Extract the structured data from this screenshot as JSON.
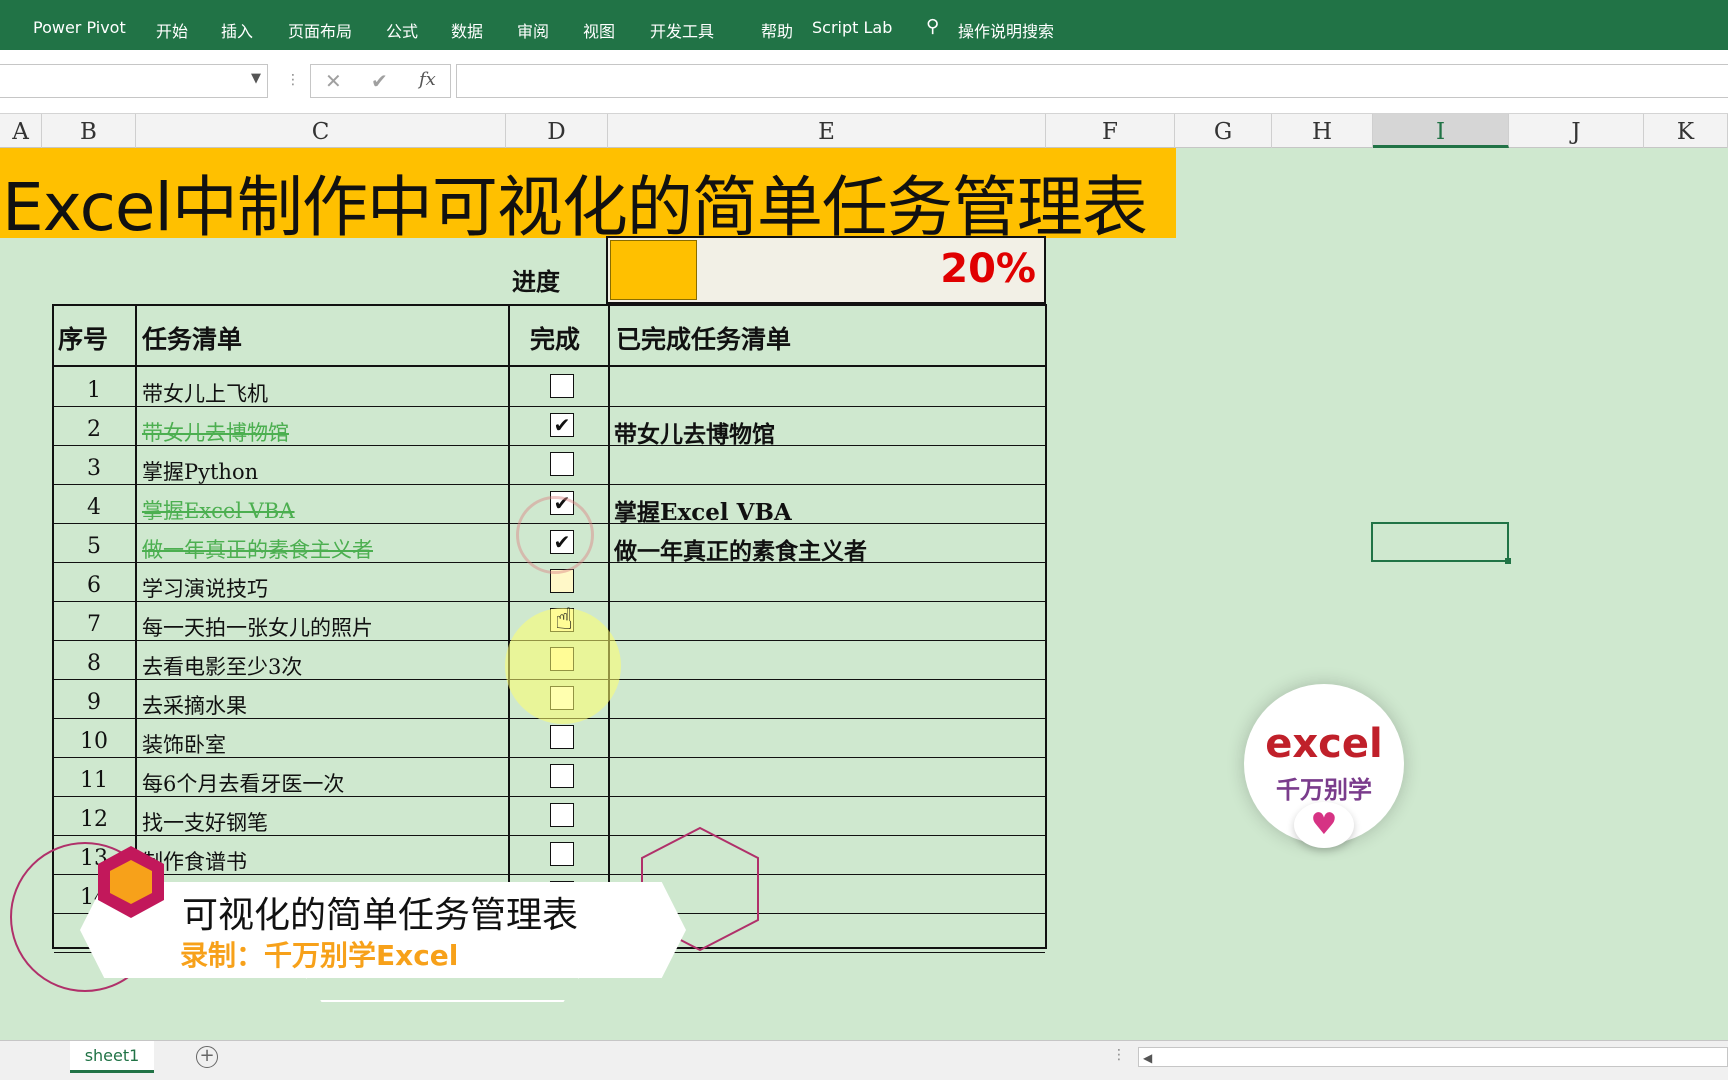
{
  "ribbon": {
    "tabs": [
      "Power Pivot",
      "开始",
      "插入",
      "页面布局",
      "公式",
      "数据",
      "审阅",
      "视图",
      "开发工具",
      "帮助",
      "Script Lab"
    ],
    "tell_me": "操作说明搜索",
    "accent_color": "#217346"
  },
  "formula_bar": {
    "name_box": "",
    "formula": "",
    "cancel_icon": "✕",
    "enter_icon": "✔",
    "fx_label": "fx"
  },
  "columns": [
    "A",
    "B",
    "C",
    "D",
    "E",
    "F",
    "G",
    "H",
    "I",
    "J",
    "K"
  ],
  "selected_column": "I",
  "title": "Excel中制作中可视化的简单任务管理表",
  "progress": {
    "label": "进度",
    "percent_text": "20%",
    "fraction": 0.2,
    "bar_color": "#ffc000",
    "text_color": "#e00000"
  },
  "table": {
    "headers": {
      "num": "序号",
      "task": "任务清单",
      "done": "完成",
      "completed": "已完成任务清单"
    },
    "rows": [
      {
        "num": "1",
        "task": "带女儿上飞机",
        "done": false,
        "completed": ""
      },
      {
        "num": "2",
        "task": "带女儿去博物馆",
        "done": true,
        "completed": "带女儿去博物馆"
      },
      {
        "num": "3",
        "task": "掌握Python",
        "done": false,
        "completed": ""
      },
      {
        "num": "4",
        "task": "掌握Excel VBA",
        "done": true,
        "completed": "掌握Excel VBA"
      },
      {
        "num": "5",
        "task": "做一年真正的素食主义者",
        "done": true,
        "completed": "做一年真正的素食主义者"
      },
      {
        "num": "6",
        "task": "学习演说技巧",
        "done": false,
        "completed": ""
      },
      {
        "num": "7",
        "task": "每一天拍一张女儿的照片",
        "done": false,
        "completed": ""
      },
      {
        "num": "8",
        "task": "去看电影至少3次",
        "done": false,
        "completed": ""
      },
      {
        "num": "9",
        "task": "去采摘水果",
        "done": false,
        "completed": ""
      },
      {
        "num": "10",
        "task": "装饰卧室",
        "done": false,
        "completed": ""
      },
      {
        "num": "11",
        "task": "每6个月去看牙医一次",
        "done": false,
        "completed": ""
      },
      {
        "num": "12",
        "task": "找一支好钢笔",
        "done": false,
        "completed": ""
      },
      {
        "num": "13",
        "task": "制作食谱书",
        "done": false,
        "completed": ""
      },
      {
        "num": "14",
        "task": "",
        "done": false,
        "completed": ""
      },
      {
        "num": "",
        "task": "",
        "done": null,
        "completed": ""
      }
    ]
  },
  "overlay": {
    "title": "可视化的简单任务管理表",
    "subtitle": "录制：千万别学Excel",
    "accent_color": "#f7a11a"
  },
  "logo": {
    "line1": "excel",
    "line2": "千万别学"
  },
  "sheet_tabs": [
    "sheet1"
  ]
}
